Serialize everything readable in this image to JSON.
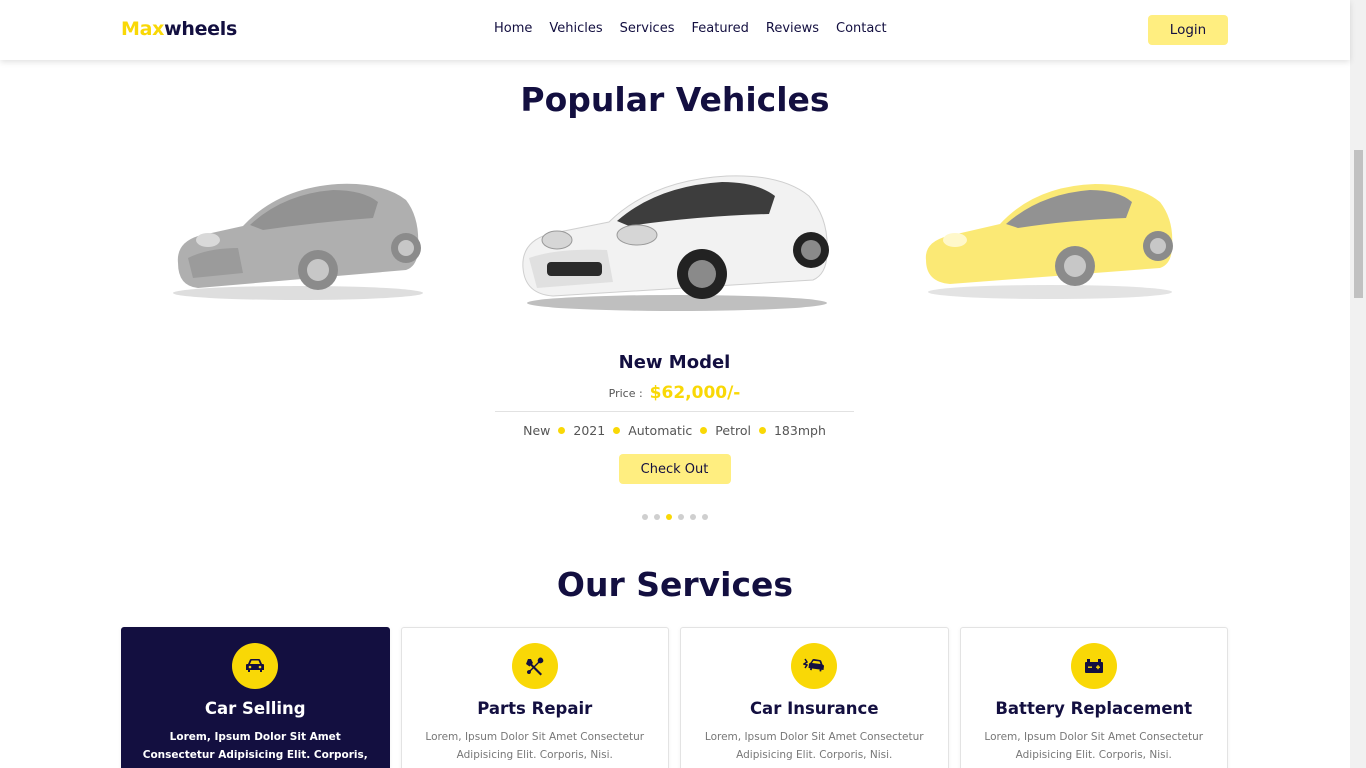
{
  "header": {
    "logo_accent": "Max",
    "logo_rest": "wheels",
    "nav": [
      "Home",
      "Vehicles",
      "Services",
      "Featured",
      "Reviews",
      "Contact"
    ],
    "login_label": "Login"
  },
  "vehicles": {
    "title_plain": "Popular",
    "title_highlight": "Vehicles",
    "cars": [
      {
        "color": "gray",
        "opacity": 0.55
      },
      {
        "color": "white",
        "opacity": 1
      },
      {
        "color": "yellow",
        "opacity": 0.55
      }
    ],
    "active": {
      "name": "New Model",
      "price_label": "Price :",
      "price": "$62,000/-",
      "specs": [
        "New",
        "2021",
        "Automatic",
        "Petrol",
        "183mph"
      ],
      "button": "Check Out"
    },
    "pagination": {
      "total": 6,
      "active_index": 2
    }
  },
  "services": {
    "title_plain": "Our",
    "title_highlight": "Services",
    "cards": [
      {
        "title": "Car Selling",
        "icon": "car-front-icon",
        "text": "Lorem, Ipsum Dolor Sit Amet Consectetur Adipisicing Elit. Corporis, Nisi."
      },
      {
        "title": "Parts Repair",
        "icon": "tools-icon",
        "text": "Lorem, Ipsum Dolor Sit Amet Consectetur Adipisicing Elit. Corporis, Nisi."
      },
      {
        "title": "Car Insurance",
        "icon": "car-crash-icon",
        "text": "Lorem, Ipsum Dolor Sit Amet Consectetur Adipisicing Elit. Corporis, Nisi."
      },
      {
        "title": "Battery Replacement",
        "icon": "car-battery-icon",
        "text": "Lorem, Ipsum Dolor Sit Amet Consectetur Adipisicing Elit. Corporis, Nisi."
      }
    ]
  },
  "colors": {
    "accent": "#f9d806",
    "accent_light": "#ffee80",
    "dark": "#130f40"
  }
}
